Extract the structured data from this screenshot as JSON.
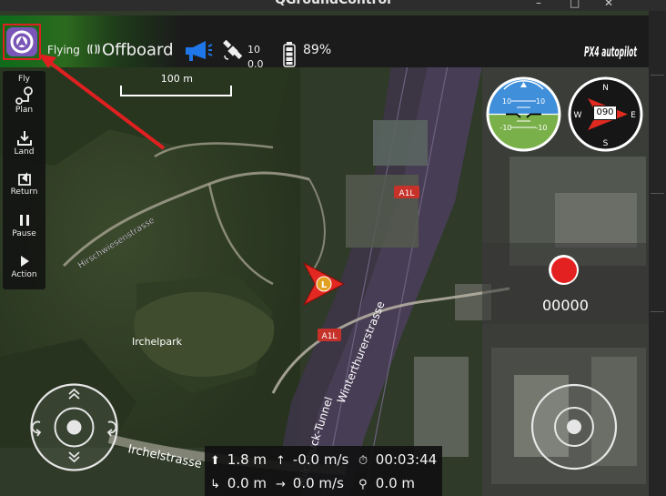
{
  "window": {
    "title": "QGroundControl",
    "buttons": [
      "–",
      "□",
      "✕"
    ]
  },
  "toolbar": {
    "flight_state": "Flying",
    "flight_mode": "Offboard",
    "gps": {
      "satellites": "10",
      "hdop": "0.0"
    },
    "battery": "89%",
    "brand_logo": "PX4 autopilot",
    "icons": {
      "app": "qgc-logo-icon",
      "mode": "signal-wave-icon",
      "messages": "megaphone-icon",
      "gps": "satellite-icon",
      "battery": "battery-icon"
    },
    "highlight_color": "#e02020"
  },
  "toolstrip": {
    "items": [
      {
        "label": "Fly",
        "icon": "fly-icon"
      },
      {
        "label": "Plan",
        "icon": "plan-icon"
      },
      {
        "label": "Land",
        "icon": "land-icon"
      },
      {
        "label": "Return",
        "icon": "return-icon"
      },
      {
        "label": "Pause",
        "icon": "pause-icon"
      },
      {
        "label": "Action",
        "icon": "action-icon"
      }
    ]
  },
  "map": {
    "scale_label": "100 m",
    "street_labels": [
      "Hirschwiesenstrasse",
      "Irchelpark",
      "Irchelstrasse",
      "Winterthurerstrasse",
      "Milchbuck-Tunnel"
    ],
    "road_shields": [
      "A1L",
      "A1L"
    ],
    "vehicle_marker": "L"
  },
  "instruments": {
    "attitude_pitch_labels": [
      "10",
      "10",
      "-10",
      "-10"
    ],
    "compass_cardinals": [
      "N",
      "E",
      "S",
      "W"
    ],
    "heading": "090"
  },
  "video": {
    "record_time": "00000"
  },
  "telemetry": {
    "altitude": "1.8 m",
    "vertical_speed": "-0.0 m/s",
    "flight_time": "00:03:44",
    "distance_home": "0.0 m",
    "ground_speed": "0.0 m/s",
    "distance_walked": "0.0 m"
  },
  "colors": {
    "record": "#e32121",
    "toolbar_green": "#0d6b1a",
    "vehicle": "#e22820"
  }
}
